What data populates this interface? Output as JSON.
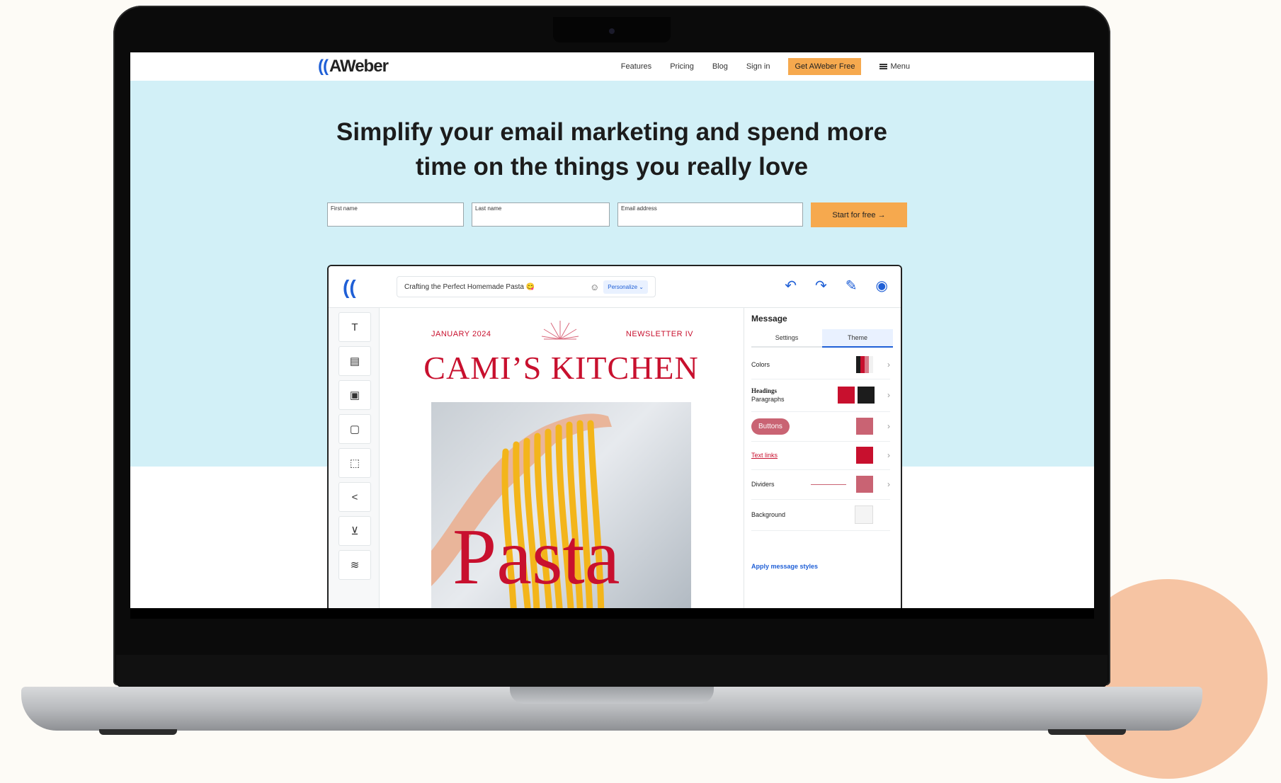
{
  "nav": {
    "logo": "AWeber",
    "links": [
      "Features",
      "Pricing",
      "Blog",
      "Sign in"
    ],
    "cta": "Get AWeber Free",
    "menu": "Menu"
  },
  "hero": {
    "headline_line1": "Simplify your email marketing and spend more",
    "headline_line2": "time on the things you really love"
  },
  "form": {
    "first_name_label": "First name",
    "last_name_label": "Last name",
    "email_label": "Email address",
    "submit_label": "Start for free →"
  },
  "editor": {
    "subject": "Crafting the Perfect Homemade Pasta",
    "subject_emoji": "😋",
    "personalize": "Personalize ⌄",
    "email": {
      "date": "JANUARY 2024",
      "issue": "NEWSLETTER IV",
      "title": "CAMI’S KITCHEN",
      "image_text": "Pasta"
    },
    "panel": {
      "title": "Message",
      "tabs": [
        "Settings",
        "Theme"
      ],
      "active_tab": "Theme",
      "rows": {
        "colors": "Colors",
        "headings": "Headings",
        "paragraphs": "Paragraphs",
        "buttons": "Buttons",
        "text_links": "Text links",
        "dividers": "Dividers",
        "background": "Background"
      },
      "apply": "Apply message styles"
    }
  },
  "colors": {
    "accent_orange": "#f6a94e",
    "brand_blue": "#1f5fd6",
    "brand_red": "#c8102e",
    "hero_bg": "#d2f0f7",
    "button_pink": "#c96373"
  }
}
